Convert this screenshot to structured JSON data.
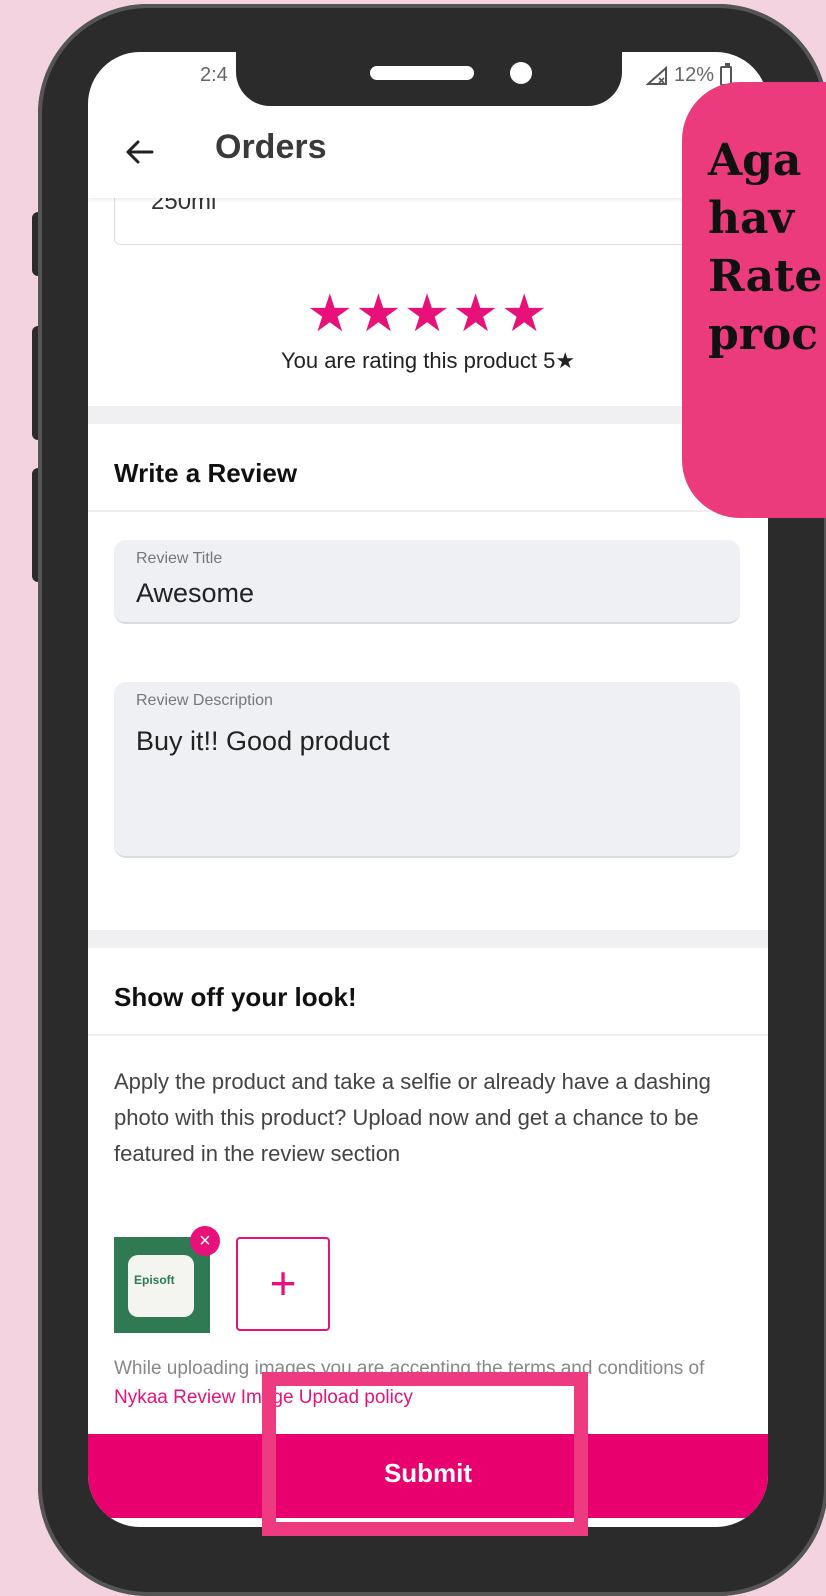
{
  "status_bar": {
    "time": "2:4",
    "battery": "12%"
  },
  "app_bar": {
    "title": "Orders"
  },
  "product": {
    "variant": "250ml"
  },
  "rating": {
    "stars": "★★★★★",
    "text": "You are rating this product 5★"
  },
  "review": {
    "section_title": "Write a Review",
    "title_label": "Review Title",
    "title_value": "Awesome",
    "description_label": "Review Description",
    "description_value": "Buy it!! Good product"
  },
  "look": {
    "section_title": "Show off your look!",
    "description": "Apply the product and take a selfie or already have a dashing photo with this product? Upload now and get a chance to be featured in the review section",
    "thumbnail_text": "Episoft",
    "remove_icon": "×",
    "add_icon": "+"
  },
  "policy": {
    "prefix": "While uploading images you are accepting the terms and conditions of ",
    "link": "Nykaa Review Image Upload policy"
  },
  "submit": {
    "label": "Submit"
  },
  "callout": {
    "text": "Aga\nhav\nRate\nproc"
  },
  "colors": {
    "accent": "#e8117a",
    "callout": "#ec3b7c",
    "background": "#f2d3df"
  }
}
